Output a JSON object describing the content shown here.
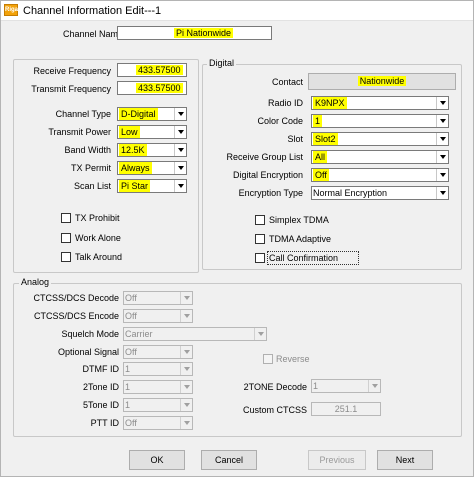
{
  "window": {
    "title": "Channel Information Edit---1",
    "app_icon_label": "Riga"
  },
  "channel_name": {
    "label": "Channel Name",
    "value": "Pi Nationwide"
  },
  "frequencies": {
    "receive_label": "Receive Frequency",
    "receive_value": "433.57500",
    "transmit_label": "Transmit Frequency",
    "transmit_value": "433.57500"
  },
  "settings": {
    "channel_type_label": "Channel Type",
    "channel_type_value": "D-Digital",
    "transmit_power_label": "Transmit Power",
    "transmit_power_value": "Low",
    "band_width_label": "Band Width",
    "band_width_value": "12.5K",
    "tx_permit_label": "TX Permit",
    "tx_permit_value": "Always",
    "scan_list_label": "Scan List",
    "scan_list_value": "Pi Star"
  },
  "checkboxes_left": {
    "tx_prohibit": "TX Prohibit",
    "work_alone": "Work Alone",
    "talk_around": "Talk Around"
  },
  "digital": {
    "group_title": "Digital",
    "contact_label": "Contact",
    "contact_value": "Nationwide",
    "radio_id_label": "Radio ID",
    "radio_id_value": "K9NPX",
    "color_code_label": "Color Code",
    "color_code_value": "1",
    "slot_label": "Slot",
    "slot_value": "Slot2",
    "receive_group_label": "Receive Group List",
    "receive_group_value": "All",
    "digital_encryption_label": "Digital Encryption",
    "digital_encryption_value": "Off",
    "encryption_type_label": "Encryption Type",
    "encryption_type_value": "Normal Encryption",
    "simplex_tdma": "Simplex TDMA",
    "tdma_adaptive": "TDMA Adaptive",
    "call_confirmation": "Call Confirmation"
  },
  "analog": {
    "group_title": "Analog",
    "ctcss_decode_label": "CTCSS/DCS Decode",
    "ctcss_decode_value": "Off",
    "ctcss_encode_label": "CTCSS/DCS Encode",
    "ctcss_encode_value": "Off",
    "squelch_mode_label": "Squelch Mode",
    "squelch_mode_value": "Carrier",
    "optional_signal_label": "Optional Signal",
    "optional_signal_value": "Off",
    "reverse_label": "Reverse",
    "dtmf_id_label": "DTMF ID",
    "dtmf_id_value": "1",
    "twotone_id_label": "2Tone ID",
    "twotone_id_value": "1",
    "twotone_decode_label": "2TONE Decode",
    "twotone_decode_value": "1",
    "fivetone_id_label": "5Tone ID",
    "fivetone_id_value": "1",
    "custom_ctcss_label": "Custom CTCSS",
    "custom_ctcss_value": "251.1",
    "ptt_id_label": "PTT ID",
    "ptt_id_value": "Off"
  },
  "buttons": {
    "ok": "OK",
    "cancel": "Cancel",
    "previous": "Previous",
    "next": "Next"
  },
  "colors": {
    "highlight": "#ffff00",
    "window_bg": "#f0f0f0",
    "app_icon": "#f2a20a"
  }
}
